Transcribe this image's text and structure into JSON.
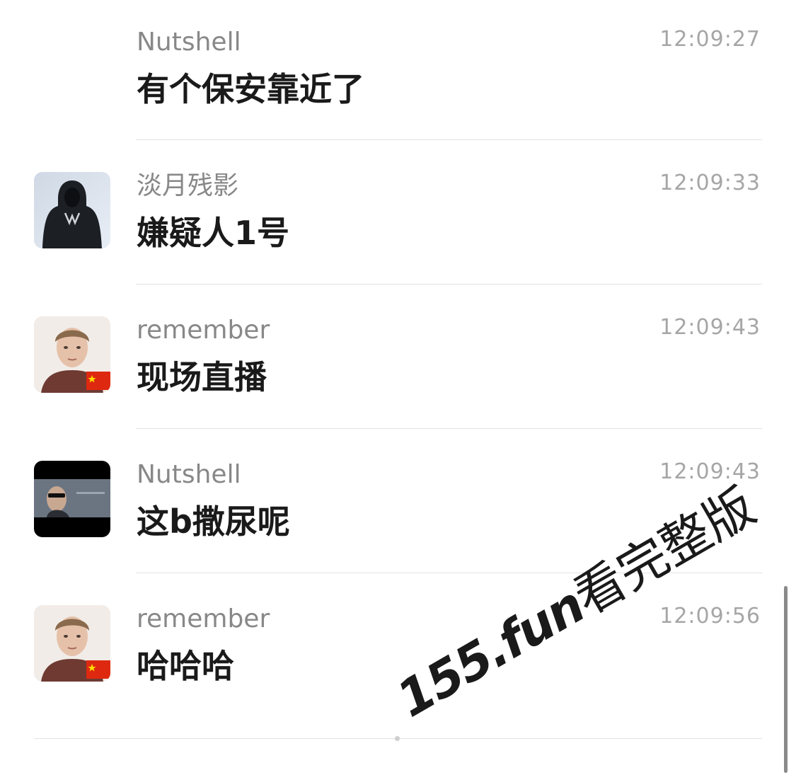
{
  "messages": [
    {
      "name": "Nutshell",
      "time": "12:09:27",
      "text": "有个保安靠近了",
      "avatar": "none"
    },
    {
      "name": "淡月残影",
      "time": "12:09:33",
      "text": "嫌疑人1号",
      "avatar": "hooded-figure"
    },
    {
      "name": "remember",
      "time": "12:09:43",
      "text": "现场直播",
      "avatar": "portrait-with-flag"
    },
    {
      "name": "Nutshell",
      "time": "12:09:43",
      "text": "这b撒尿呢",
      "avatar": "movie-still"
    },
    {
      "name": "remember",
      "time": "12:09:56",
      "text": "哈哈哈",
      "avatar": "portrait-with-flag"
    }
  ],
  "watermark": {
    "domain": "155.fun",
    "text": "看完整版"
  },
  "colors": {
    "name": "#888888",
    "time": "#a6a6a6",
    "text": "#1a1a1a",
    "divider": "#e2e2e2",
    "background": "#ffffff"
  }
}
